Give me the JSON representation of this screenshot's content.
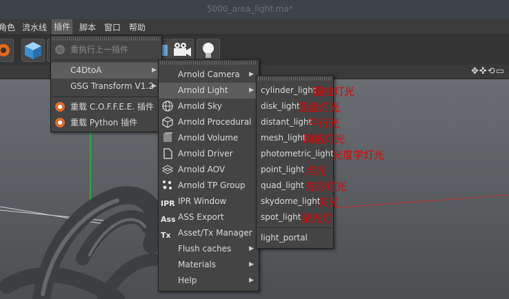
{
  "window": {
    "title": "5000_area_light.ma*"
  },
  "menubar": {
    "items": [
      {
        "label": "角色"
      },
      {
        "label": "流水线"
      },
      {
        "label": "插件"
      },
      {
        "label": "脚本"
      },
      {
        "label": "窗口"
      },
      {
        "label": "帮助"
      }
    ]
  },
  "plugins_menu": {
    "rerun_label": "重执行上一插件",
    "c4dtoa_label": "C4DtoA",
    "gsg_label": "GSG Transform V1.2",
    "reload_coffee_label": "重载 C.O.F.F.E.E. 插件",
    "reload_python_label": "重载 Python 插件"
  },
  "c4dtoa_menu": {
    "items": [
      {
        "label": "Arnold Camera",
        "icon": "camera-icon"
      },
      {
        "label": "Arnold Light",
        "icon": "light-icon"
      },
      {
        "label": "Arnold Sky",
        "icon": "sky-icon"
      },
      {
        "label": "Arnold Procedural",
        "icon": "procedural-icon"
      },
      {
        "label": "Arnold Volume",
        "icon": "volume-icon"
      },
      {
        "label": "Arnold Driver",
        "icon": "driver-icon"
      },
      {
        "label": "Arnold AOV",
        "icon": "aov-icon"
      },
      {
        "label": "Arnold TP Group",
        "icon": "tp-group-icon"
      },
      {
        "label": "IPR Window",
        "icon_text": "IPR"
      },
      {
        "label": "ASS Export",
        "icon_text": "Ass"
      },
      {
        "label": "Asset/Tx Manager",
        "icon_text": "Tx"
      },
      {
        "label": "Flush caches"
      },
      {
        "label": "Materials"
      },
      {
        "label": "Help"
      }
    ]
  },
  "light_menu": {
    "items": [
      {
        "label": "cylinder_light",
        "note": "圆柱灯光"
      },
      {
        "label": "disk_light",
        "note": "圆盘灯光"
      },
      {
        "label": "distant_light",
        "note": "平行光"
      },
      {
        "label": "mesh_light",
        "note": "网格灯光"
      },
      {
        "label": "photometric_light",
        "note": "光度学灯光"
      },
      {
        "label": "point_light",
        "note": "点光"
      },
      {
        "label": "quad_light",
        "note": "方形灯光"
      },
      {
        "label": "skydome_light",
        "note": "天光"
      },
      {
        "label": "spot_light",
        "note": "聚光灯"
      },
      {
        "label": "light_portal",
        "note": ""
      }
    ]
  },
  "panel": {
    "nav_icons": "✥✜⟲▭"
  },
  "colors": {
    "annotation": "#e00000",
    "menu_bg": "#444444",
    "highlight": "#5d5d5d"
  }
}
